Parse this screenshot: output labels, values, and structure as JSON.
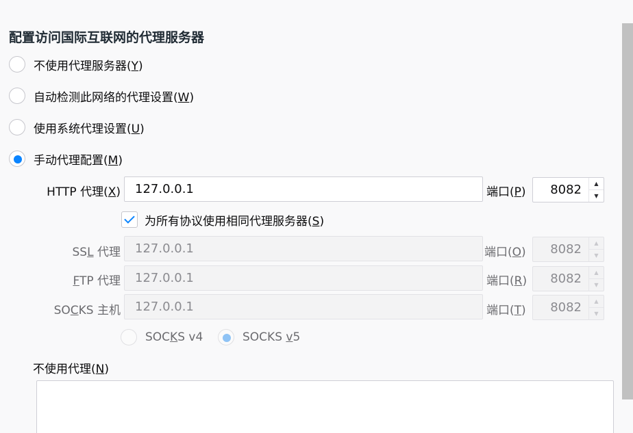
{
  "section": {
    "title": "配置访问国际互联网的代理服务器"
  },
  "options": {
    "no_proxy": {
      "label": "不使用代理服务器(",
      "key": "Y",
      "suffix": ")",
      "checked": false
    },
    "auto_detect": {
      "label": "自动检测此网络的代理设置(",
      "key": "W",
      "suffix": ")",
      "checked": false
    },
    "system": {
      "label": "使用系统代理设置(",
      "key": "U",
      "suffix": ")",
      "checked": false
    },
    "manual": {
      "label": "手动代理配置(",
      "key": "M",
      "suffix": ")",
      "checked": true
    }
  },
  "http": {
    "label_pre": "HTTP 代理(",
    "key": "X",
    "label_post": ")",
    "value": "127.0.0.1",
    "port_pre": "端口(",
    "port_key": "P",
    "port_post": ")",
    "port": "8082"
  },
  "share": {
    "label_pre": "为所有协议使用相同代理服务器(",
    "key": "S",
    "label_post": ")",
    "checked": true
  },
  "ssl": {
    "label_pre": "SS",
    "key": "L",
    "label_post": " 代理",
    "value": "127.0.0.1",
    "port_pre": "端口(",
    "port_key": "O",
    "port_post": ")",
    "port": "8082"
  },
  "ftp": {
    "label_pre": "",
    "key": "F",
    "label_post": "TP 代理",
    "value": "127.0.0.1",
    "port_pre": "端口(",
    "port_key": "R",
    "port_post": ")",
    "port": "8082"
  },
  "socks": {
    "label_pre": "SO",
    "key": "C",
    "label_post": "KS 主机",
    "value": "127.0.0.1",
    "port_pre": "端口(",
    "port_key": "T",
    "port_post": ")",
    "port": "8082"
  },
  "socks_version": {
    "v4": {
      "pre": "SOC",
      "key": "K",
      "post": "S v4",
      "checked": false
    },
    "v5": {
      "pre": "SOCKS ",
      "key": "v",
      "post": "5",
      "checked": true
    }
  },
  "no_proxy_for": {
    "label_pre": "不使用代理(",
    "key": "N",
    "label_post": ")",
    "value": ""
  },
  "colors": {
    "accent": "#0a84ff",
    "background": "#f9f9fa"
  }
}
